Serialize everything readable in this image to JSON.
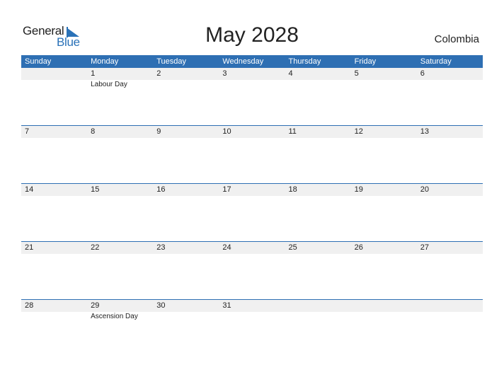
{
  "logo": {
    "word1": "General",
    "word2": "Blue"
  },
  "title": "May 2028",
  "country": "Colombia",
  "weekdays": [
    "Sunday",
    "Monday",
    "Tuesday",
    "Wednesday",
    "Thursday",
    "Friday",
    "Saturday"
  ],
  "weeks": [
    {
      "days": [
        "",
        "1",
        "2",
        "3",
        "4",
        "5",
        "6"
      ],
      "events": [
        "",
        "Labour Day",
        "",
        "",
        "",
        "",
        ""
      ]
    },
    {
      "days": [
        "7",
        "8",
        "9",
        "10",
        "11",
        "12",
        "13"
      ],
      "events": [
        "",
        "",
        "",
        "",
        "",
        "",
        ""
      ]
    },
    {
      "days": [
        "14",
        "15",
        "16",
        "17",
        "18",
        "19",
        "20"
      ],
      "events": [
        "",
        "",
        "",
        "",
        "",
        "",
        ""
      ]
    },
    {
      "days": [
        "21",
        "22",
        "23",
        "24",
        "25",
        "26",
        "27"
      ],
      "events": [
        "",
        "",
        "",
        "",
        "",
        "",
        ""
      ]
    },
    {
      "days": [
        "28",
        "29",
        "30",
        "31",
        "",
        "",
        ""
      ],
      "events": [
        "",
        "Ascension Day",
        "",
        "",
        "",
        "",
        ""
      ]
    }
  ],
  "colors": {
    "accent": "#2e6fb3",
    "band": "#f0f0f0"
  }
}
